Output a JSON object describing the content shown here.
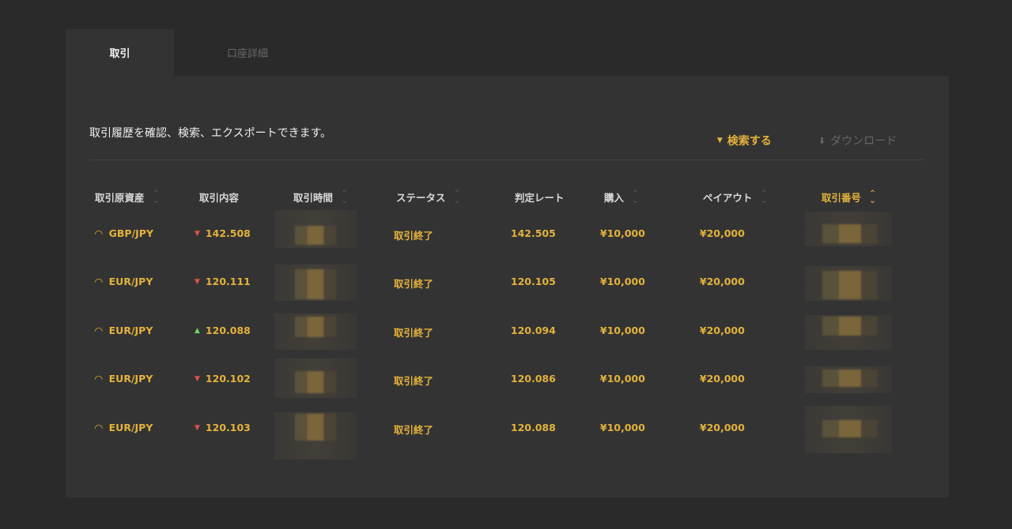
{
  "tabs": [
    {
      "label": "取引",
      "active": true
    },
    {
      "label": "口座詳細",
      "active": false
    }
  ],
  "description": "取引履歴を確認、検索、エクスポートできます。",
  "toolbar": {
    "search_label": "検索する",
    "download_label": "ダウンロード"
  },
  "columns": [
    {
      "label": "取引原資産",
      "sortable": true
    },
    {
      "label": "取引内容",
      "sortable": false
    },
    {
      "label": "取引時間",
      "sortable": true
    },
    {
      "label": "ステータス",
      "sortable": true
    },
    {
      "label": "判定レート",
      "sortable": false
    },
    {
      "label": "購入",
      "sortable": true
    },
    {
      "label": "ペイアウト",
      "sortable": true
    },
    {
      "label": "取引番号",
      "sortable": true
    }
  ],
  "rows": [
    {
      "asset": "GBP/JPY",
      "direction": "down",
      "entry": "142.508",
      "status": "取引終了",
      "rate": "142.505",
      "buy": "¥10,000",
      "payout": "¥20,000"
    },
    {
      "asset": "EUR/JPY",
      "direction": "down",
      "entry": "120.111",
      "status": "取引終了",
      "rate": "120.105",
      "buy": "¥10,000",
      "payout": "¥20,000"
    },
    {
      "asset": "EUR/JPY",
      "direction": "up",
      "entry": "120.088",
      "status": "取引終了",
      "rate": "120.094",
      "buy": "¥10,000",
      "payout": "¥20,000"
    },
    {
      "asset": "EUR/JPY",
      "direction": "down",
      "entry": "120.102",
      "status": "取引終了",
      "rate": "120.086",
      "buy": "¥10,000",
      "payout": "¥20,000"
    },
    {
      "asset": "EUR/JPY",
      "direction": "down",
      "entry": "120.103",
      "status": "取引終了",
      "rate": "120.088",
      "buy": "¥10,000",
      "payout": "¥20,000"
    }
  ],
  "colors": {
    "accent": "#e3b23c",
    "down": "#e05050",
    "up": "#6fd36f"
  }
}
